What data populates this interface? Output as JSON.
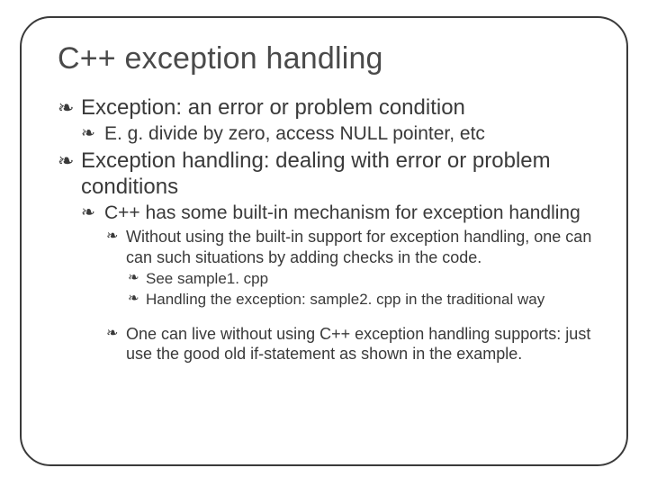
{
  "title": "C++ exception handling",
  "items": {
    "p1": "Exception: an error or problem condition",
    "p1_1": "E. g. divide by zero, access NULL pointer, etc",
    "p2": "Exception handling: dealing with  error or problem conditions",
    "p2_1": "C++ has some built-in mechanism for exception handling",
    "p2_1_1": "Without using the built-in support for exception handling, one can can such situations by adding checks in the code.",
    "p2_1_1_a": "See sample1. cpp",
    "p2_1_1_b": "Handling the exception: sample2. cpp in the traditional way",
    "p2_1_2": "One can live without using C++ exception handling supports: just use the good old if-statement as shown in the example."
  }
}
